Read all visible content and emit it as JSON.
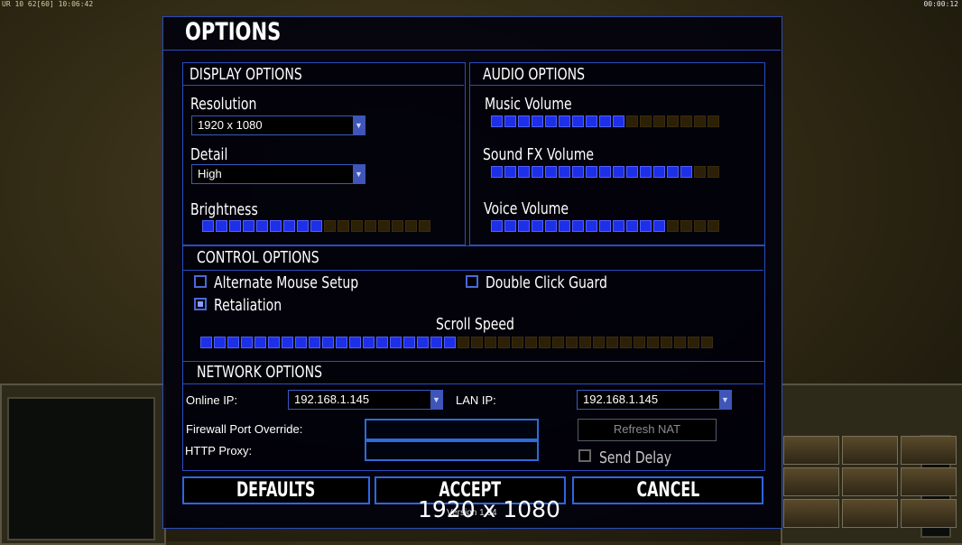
{
  "hud": {
    "left": "UR 10 62[60] 10:06:42",
    "right": "00:00:12"
  },
  "dialog": {
    "title": "OPTIONS"
  },
  "display": {
    "header": "DISPLAY OPTIONS",
    "resolution_label": "Resolution",
    "resolution_value": "1920 x 1080",
    "detail_label": "Detail",
    "detail_value": "High",
    "brightness_label": "Brightness",
    "brightness_level": 9,
    "brightness_max": 17
  },
  "audio": {
    "header": "AUDIO OPTIONS",
    "music_label": "Music Volume",
    "music_level": 10,
    "music_max": 17,
    "sfx_label": "Sound FX Volume",
    "sfx_level": 15,
    "sfx_max": 17,
    "voice_label": "Voice Volume",
    "voice_level": 13,
    "voice_max": 17
  },
  "control": {
    "header": "CONTROL OPTIONS",
    "alt_mouse_label": "Alternate Mouse Setup",
    "alt_mouse_checked": false,
    "retaliation_label": "Retaliation",
    "retaliation_checked": true,
    "double_click_label": "Double Click Guard",
    "double_click_checked": false,
    "scroll_label": "Scroll Speed",
    "scroll_level": 19,
    "scroll_max": 38
  },
  "network": {
    "header": "NETWORK OPTIONS",
    "online_ip_label": "Online IP:",
    "online_ip_value": "192.168.1.145",
    "lan_ip_label": "LAN IP:",
    "lan_ip_value": "192.168.1.145",
    "firewall_label": "Firewall Port Override:",
    "firewall_value": "",
    "proxy_label": "HTTP Proxy:",
    "proxy_value": "",
    "refresh_nat_label": "Refresh NAT",
    "send_delay_label": "Send Delay",
    "send_delay_checked": false
  },
  "buttons": {
    "defaults": "DEFAULTS",
    "accept": "ACCEPT",
    "cancel": "CANCEL"
  },
  "version": "Version 1.04",
  "overlay_text": "1920 x 1080",
  "colors": {
    "accent": "#2a4dbf",
    "bar_on": "#1e2fe8",
    "bar_off": "#2c2006"
  }
}
